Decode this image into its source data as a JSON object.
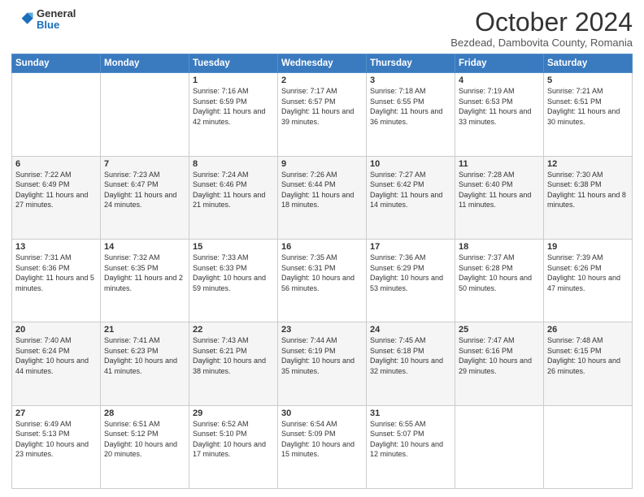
{
  "header": {
    "logo": {
      "general": "General",
      "blue": "Blue"
    },
    "title": "October 2024",
    "location": "Bezdead, Dambovita County, Romania"
  },
  "weekdays": [
    "Sunday",
    "Monday",
    "Tuesday",
    "Wednesday",
    "Thursday",
    "Friday",
    "Saturday"
  ],
  "weeks": [
    [
      {
        "day": "",
        "info": ""
      },
      {
        "day": "",
        "info": ""
      },
      {
        "day": "1",
        "info": "Sunrise: 7:16 AM\nSunset: 6:59 PM\nDaylight: 11 hours and 42 minutes."
      },
      {
        "day": "2",
        "info": "Sunrise: 7:17 AM\nSunset: 6:57 PM\nDaylight: 11 hours and 39 minutes."
      },
      {
        "day": "3",
        "info": "Sunrise: 7:18 AM\nSunset: 6:55 PM\nDaylight: 11 hours and 36 minutes."
      },
      {
        "day": "4",
        "info": "Sunrise: 7:19 AM\nSunset: 6:53 PM\nDaylight: 11 hours and 33 minutes."
      },
      {
        "day": "5",
        "info": "Sunrise: 7:21 AM\nSunset: 6:51 PM\nDaylight: 11 hours and 30 minutes."
      }
    ],
    [
      {
        "day": "6",
        "info": "Sunrise: 7:22 AM\nSunset: 6:49 PM\nDaylight: 11 hours and 27 minutes."
      },
      {
        "day": "7",
        "info": "Sunrise: 7:23 AM\nSunset: 6:47 PM\nDaylight: 11 hours and 24 minutes."
      },
      {
        "day": "8",
        "info": "Sunrise: 7:24 AM\nSunset: 6:46 PM\nDaylight: 11 hours and 21 minutes."
      },
      {
        "day": "9",
        "info": "Sunrise: 7:26 AM\nSunset: 6:44 PM\nDaylight: 11 hours and 18 minutes."
      },
      {
        "day": "10",
        "info": "Sunrise: 7:27 AM\nSunset: 6:42 PM\nDaylight: 11 hours and 14 minutes."
      },
      {
        "day": "11",
        "info": "Sunrise: 7:28 AM\nSunset: 6:40 PM\nDaylight: 11 hours and 11 minutes."
      },
      {
        "day": "12",
        "info": "Sunrise: 7:30 AM\nSunset: 6:38 PM\nDaylight: 11 hours and 8 minutes."
      }
    ],
    [
      {
        "day": "13",
        "info": "Sunrise: 7:31 AM\nSunset: 6:36 PM\nDaylight: 11 hours and 5 minutes."
      },
      {
        "day": "14",
        "info": "Sunrise: 7:32 AM\nSunset: 6:35 PM\nDaylight: 11 hours and 2 minutes."
      },
      {
        "day": "15",
        "info": "Sunrise: 7:33 AM\nSunset: 6:33 PM\nDaylight: 10 hours and 59 minutes."
      },
      {
        "day": "16",
        "info": "Sunrise: 7:35 AM\nSunset: 6:31 PM\nDaylight: 10 hours and 56 minutes."
      },
      {
        "day": "17",
        "info": "Sunrise: 7:36 AM\nSunset: 6:29 PM\nDaylight: 10 hours and 53 minutes."
      },
      {
        "day": "18",
        "info": "Sunrise: 7:37 AM\nSunset: 6:28 PM\nDaylight: 10 hours and 50 minutes."
      },
      {
        "day": "19",
        "info": "Sunrise: 7:39 AM\nSunset: 6:26 PM\nDaylight: 10 hours and 47 minutes."
      }
    ],
    [
      {
        "day": "20",
        "info": "Sunrise: 7:40 AM\nSunset: 6:24 PM\nDaylight: 10 hours and 44 minutes."
      },
      {
        "day": "21",
        "info": "Sunrise: 7:41 AM\nSunset: 6:23 PM\nDaylight: 10 hours and 41 minutes."
      },
      {
        "day": "22",
        "info": "Sunrise: 7:43 AM\nSunset: 6:21 PM\nDaylight: 10 hours and 38 minutes."
      },
      {
        "day": "23",
        "info": "Sunrise: 7:44 AM\nSunset: 6:19 PM\nDaylight: 10 hours and 35 minutes."
      },
      {
        "day": "24",
        "info": "Sunrise: 7:45 AM\nSunset: 6:18 PM\nDaylight: 10 hours and 32 minutes."
      },
      {
        "day": "25",
        "info": "Sunrise: 7:47 AM\nSunset: 6:16 PM\nDaylight: 10 hours and 29 minutes."
      },
      {
        "day": "26",
        "info": "Sunrise: 7:48 AM\nSunset: 6:15 PM\nDaylight: 10 hours and 26 minutes."
      }
    ],
    [
      {
        "day": "27",
        "info": "Sunrise: 6:49 AM\nSunset: 5:13 PM\nDaylight: 10 hours and 23 minutes."
      },
      {
        "day": "28",
        "info": "Sunrise: 6:51 AM\nSunset: 5:12 PM\nDaylight: 10 hours and 20 minutes."
      },
      {
        "day": "29",
        "info": "Sunrise: 6:52 AM\nSunset: 5:10 PM\nDaylight: 10 hours and 17 minutes."
      },
      {
        "day": "30",
        "info": "Sunrise: 6:54 AM\nSunset: 5:09 PM\nDaylight: 10 hours and 15 minutes."
      },
      {
        "day": "31",
        "info": "Sunrise: 6:55 AM\nSunset: 5:07 PM\nDaylight: 10 hours and 12 minutes."
      },
      {
        "day": "",
        "info": ""
      },
      {
        "day": "",
        "info": ""
      }
    ]
  ]
}
